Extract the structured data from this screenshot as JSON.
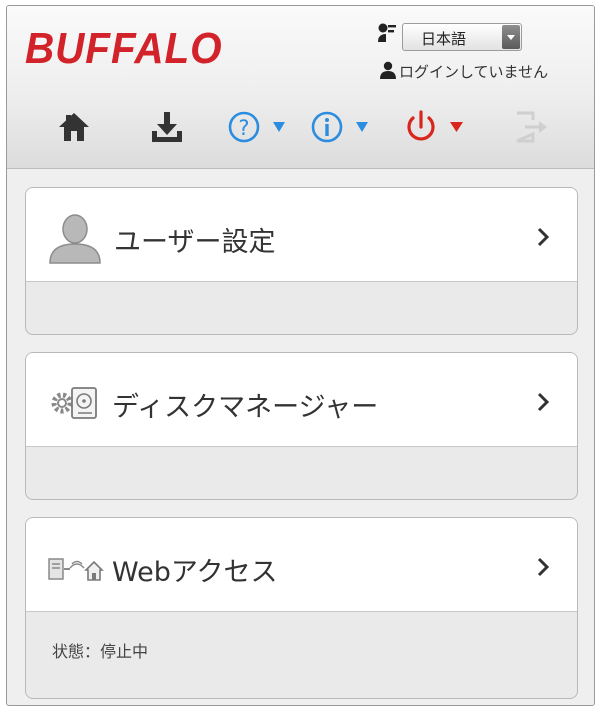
{
  "header": {
    "logo_text": "BUFFALO",
    "language": {
      "selected": "日本語"
    },
    "login_status": "ログインしていません",
    "toolbar_icons": [
      "home-icon",
      "download-icon",
      "help-icon",
      "info-icon",
      "power-icon",
      "logout-icon"
    ]
  },
  "menu": {
    "items": [
      {
        "label": "ユーザー設定",
        "icon": "user-icon"
      },
      {
        "label": "ディスクマネージャー",
        "icon": "disk-manager-icon"
      },
      {
        "label": "Webアクセス",
        "icon": "web-access-icon",
        "status": "状態：停止中"
      }
    ]
  },
  "colors": {
    "brand": "#d2232a",
    "help_info_blue": "#2b8de0",
    "power_red": "#d9261c",
    "icon_dark": "#333333"
  }
}
